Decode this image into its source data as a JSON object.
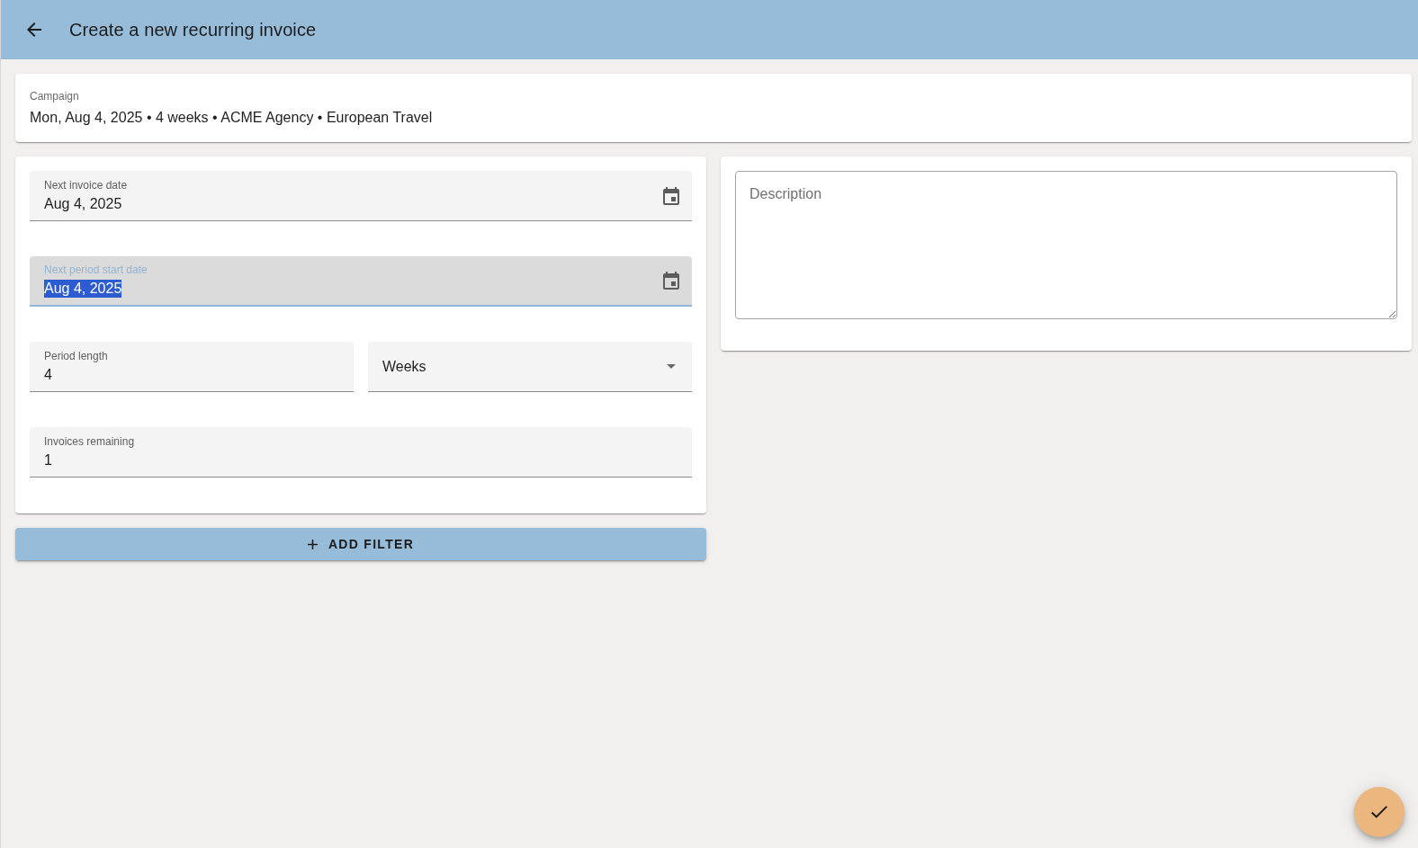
{
  "header": {
    "title": "Create a new recurring invoice"
  },
  "campaign": {
    "label": "Campaign",
    "value": "Mon, Aug 4, 2025 • 4 weeks • ACME Agency • European Travel"
  },
  "form": {
    "rows": [
      {
        "fields": [
          {
            "kind": "date",
            "label": "Next invoice date",
            "value": "Aug 4, 2025",
            "focused": false
          }
        ]
      },
      {
        "fields": [
          {
            "kind": "date",
            "label": "Next period start date",
            "value": "Aug 4, 2025",
            "focused": true
          }
        ]
      },
      {
        "fields": [
          {
            "kind": "number",
            "label": "Period length",
            "value": "4",
            "focused": false
          },
          {
            "kind": "select",
            "value": "Weeks",
            "focused": false
          }
        ]
      },
      {
        "fields": [
          {
            "kind": "number",
            "label": "Invoices remaining",
            "value": "1",
            "focused": false
          }
        ]
      }
    ]
  },
  "description": {
    "placeholder": "Description"
  },
  "add_filter_button": {
    "label": "ADD FILTER"
  }
}
